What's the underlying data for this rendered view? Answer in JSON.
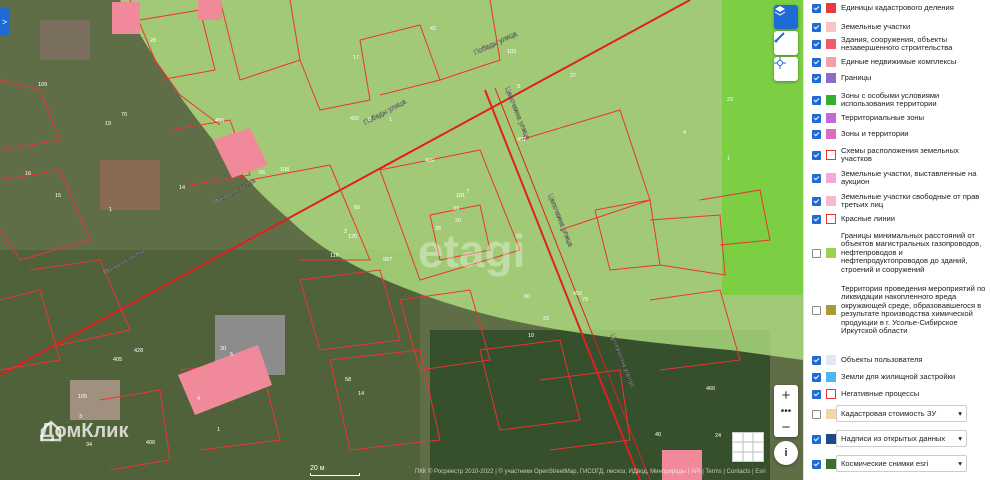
{
  "map": {
    "left_tab": ">",
    "watermark": "ДомКлик",
    "etagi": "etagi",
    "scale_label": "20 м",
    "attribution": "ПКК © Росреестр 2010-2022 | © участники OpenStreetMap, ГИСОГД, лесхоз, ИДвод, Минприроды | API | Terms | Contacts | Esri",
    "street_labels": [
      "Победы улица",
      "Победы улица",
      "Победы улица",
      "Победы улица"
    ],
    "road_labels": [
      "Цепочкина улица",
      "Цепочкина улица",
      "Цепочкина улица"
    ],
    "parcel_labels": [
      "997",
      "19",
      "120",
      "105",
      "181",
      "5",
      "103",
      "1",
      "3",
      "35",
      "28",
      "24",
      "1",
      "23",
      "116",
      "407",
      "406",
      "402",
      "409",
      "428",
      "108",
      "3",
      "4",
      "8",
      "7",
      "79",
      "70",
      "17",
      "15",
      "60",
      "1",
      "2",
      "58",
      "65",
      "456",
      "37",
      "30",
      "40",
      "466",
      "452",
      "42",
      "56",
      "14",
      "10",
      "1",
      "16",
      "33",
      "34",
      "14",
      "20",
      "405",
      "4",
      "109",
      "33"
    ],
    "zoom_in": "+",
    "zoom_dot": "•••",
    "zoom_out": "−",
    "info_icon": "i"
  },
  "panel": {
    "colors": {
      "accent": "#1e6bd6",
      "zone_green": "#76d03b",
      "light_green": "#b8e986"
    },
    "layers": [
      {
        "label": "Единицы кадастрового деления",
        "checked": true,
        "swatch": "#e8393d"
      },
      {
        "label": "Земельные участки",
        "checked": true,
        "swatch": "#f8c5c5"
      },
      {
        "label": "Здания, сооружения, объекты незавершенного строительства",
        "checked": true,
        "swatch": "#f05a6a"
      },
      {
        "label": "Единые недвижимые комплексы",
        "checked": true,
        "swatch": "#f3a0a8"
      },
      {
        "label": "Границы",
        "checked": true,
        "swatch": "#8f6bc5"
      },
      {
        "label": "Зоны с особыми условиями использования территории",
        "checked": true,
        "swatch": "#34b02e"
      },
      {
        "label": "Территориальные зоны",
        "checked": true,
        "swatch": "#c06bd6"
      },
      {
        "label": "Зоны и территории",
        "checked": true,
        "swatch": "#d96bc5"
      },
      {
        "label": "Схемы расположения земельных участков",
        "checked": true,
        "swatch": "#ffffff"
      },
      {
        "label": "Земельные участки, выставленные на аукцион",
        "checked": true,
        "swatch": "#f6a8d8"
      },
      {
        "label": "Земельные участки свободные от прав третьих лиц",
        "checked": true,
        "swatch": "#f7b8d0"
      },
      {
        "label": "Красные линии",
        "checked": true,
        "swatch": "#ffffff"
      },
      {
        "label": "Границы минимальных расстояний от объектов магистральных газопроводов, нефтепроводов и нефтепродуктопроводов до зданий, строений и сооружений",
        "checked": false,
        "swatch": "#9ad34a"
      },
      {
        "label": "Территория проведения мероприятий по ликвидации накопленного вреда окружающей среде, образовавшегося в результате производства химической продукции в г. Усолье-Сибирское Иркутской области",
        "checked": false,
        "swatch": "#a89b3a"
      },
      {
        "label": "Объекты пользователя",
        "checked": true,
        "swatch": "#dfe6f5"
      },
      {
        "label": "Земли для жилищной застройки",
        "checked": true,
        "swatch": "#4fb4f0"
      },
      {
        "label": "Негативные процессы",
        "checked": true,
        "swatch": "#ffffff"
      }
    ],
    "selects": [
      {
        "label": "Кадастровая стоимость ЗУ",
        "checked": false,
        "swatch": "#f5d6a6"
      },
      {
        "label": "Надписи из открытых данных",
        "checked": true,
        "swatch": "#1e4a8a"
      },
      {
        "label": "Космические снимки esri",
        "checked": true,
        "swatch": "#3d6e2e"
      }
    ],
    "select_arrow": "▾"
  }
}
